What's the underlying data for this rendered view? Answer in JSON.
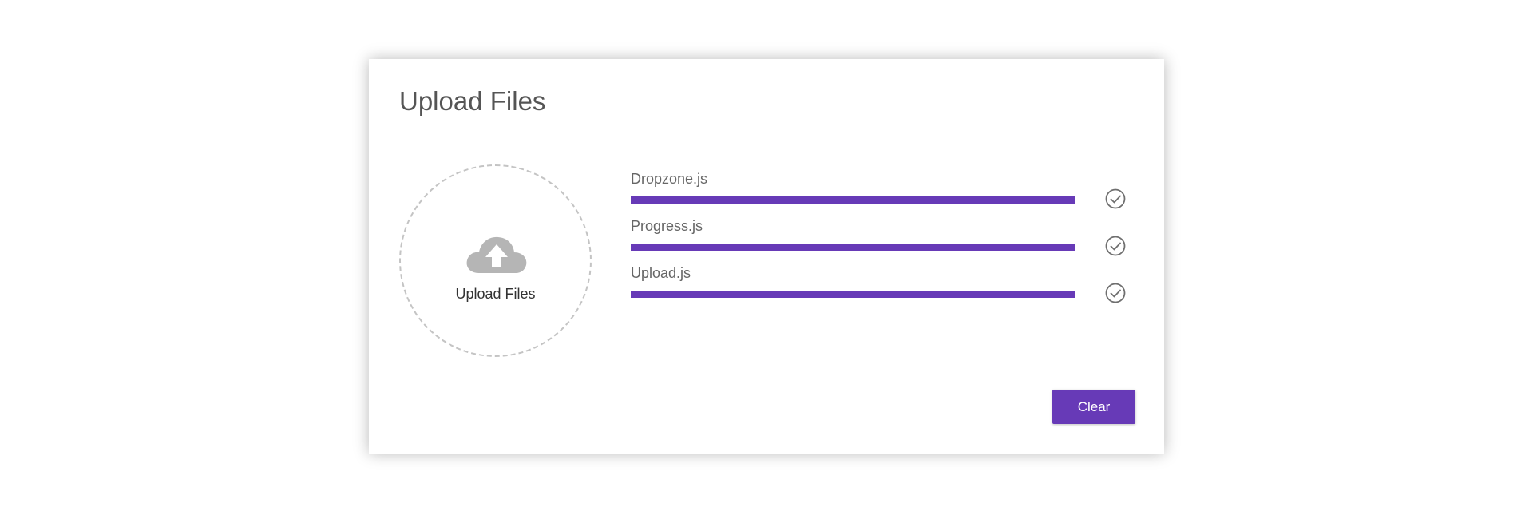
{
  "card": {
    "title": "Upload Files"
  },
  "dropzone": {
    "label": "Upload Files",
    "icon": "cloud-upload-icon"
  },
  "files": [
    {
      "name": "Dropzone.js",
      "progress": 1.0,
      "status_icon": "check-circle-icon"
    },
    {
      "name": "Progress.js",
      "progress": 1.0,
      "status_icon": "check-circle-icon"
    },
    {
      "name": "Upload.js",
      "progress": 1.0,
      "status_icon": "check-circle-icon"
    }
  ],
  "actions": {
    "clear_label": "Clear"
  },
  "colors": {
    "accent": "#673ab7",
    "icon_gray": "#b5b5b5",
    "text": "#555555"
  }
}
